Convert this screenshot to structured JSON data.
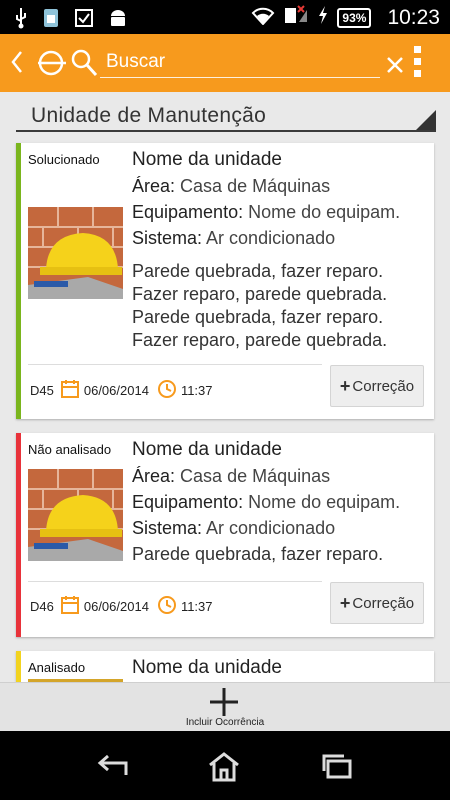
{
  "status_bar": {
    "battery": "93%",
    "time": "10:23",
    "icons": [
      "usb-icon",
      "sim-icon",
      "checkbox-icon",
      "android-icon",
      "wifi-icon",
      "signal-no-sim-icon",
      "charging-icon",
      "battery-icon"
    ]
  },
  "app_bar": {
    "search_placeholder": "Buscar",
    "accent_color": "#f79a1d"
  },
  "section": {
    "title": "Unidade de Manutenção"
  },
  "cards": [
    {
      "status": "Solucionado",
      "status_color": "#7ab51d",
      "title": "Nome da unidade",
      "area_label": "Área:",
      "area_value": "Casa de Máquinas",
      "equip_label": "Equipamento:",
      "equip_value": "Nome do equipam.",
      "system_label": "Sistema:",
      "system_value": "Ar condicionado",
      "description": "Parede quebrada, fazer reparo. Fazer reparo, parede quebrada. Parede quebrada, fazer reparo. Fazer reparo, parede quebrada.",
      "code": "D45",
      "date": "06/06/2014",
      "time": "11:37",
      "button_label": "Correção"
    },
    {
      "status": "Não analisado",
      "status_color": "#e8323a",
      "title": "Nome da unidade",
      "area_label": "Área:",
      "area_value": "Casa de Máquinas",
      "equip_label": "Equipamento:",
      "equip_value": "Nome do equipam.",
      "system_label": "Sistema:",
      "system_value": "Ar condicionado",
      "description": "Parede quebrada, fazer reparo.",
      "code": "D46",
      "date": "06/06/2014",
      "time": "11:37",
      "button_label": "Correção"
    },
    {
      "status": "Analisado",
      "status_color": "#f2d31f",
      "title": "Nome da unidade"
    }
  ],
  "action_bar": {
    "label": "Incluir Ocorrência"
  },
  "nav_bar": {
    "buttons": [
      "back-nav-icon",
      "home-nav-icon",
      "recent-apps-icon"
    ]
  }
}
